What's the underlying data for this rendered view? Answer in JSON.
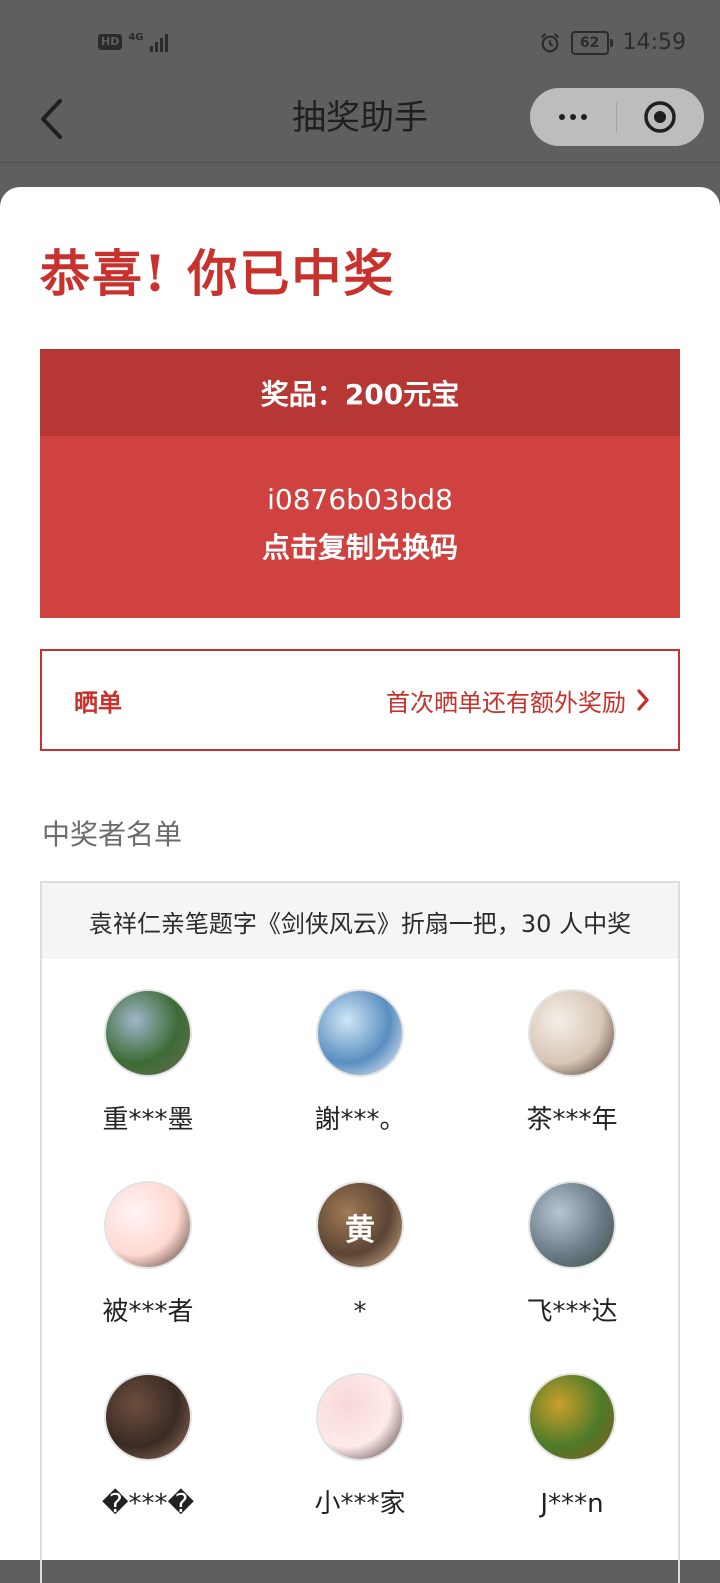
{
  "status_bar": {
    "hd": "HD",
    "network": "4G",
    "battery": "62",
    "time": "14:59"
  },
  "nav": {
    "title": "抽奖助手"
  },
  "result": {
    "congrats": "恭喜! 你已中奖",
    "prize_label": "奖品：200元宝",
    "redeem_code": "i0876b03bd8",
    "copy_text": "点击复制兑换码"
  },
  "share": {
    "label": "晒单",
    "hint": "首次晒单还有额外奖励"
  },
  "winners": {
    "title": "中奖者名单",
    "prize_desc": "袁祥仁亲笔题字《剑侠风云》折扇一把，30 人中奖",
    "list": [
      {
        "name": "重***墨",
        "avatar": "photo-garden",
        "colors": [
          "#9fb6c9",
          "#3d6b35",
          "#6d6d55"
        ]
      },
      {
        "name": "謝***。",
        "avatar": "cartoon-stitch",
        "colors": [
          "#cfe6f6",
          "#5a8ec0",
          "#ffffff"
        ]
      },
      {
        "name": "茶***年",
        "avatar": "photo-girl",
        "colors": [
          "#f4efe9",
          "#d8c6b6",
          "#3a2a22"
        ]
      },
      {
        "name": "被***者",
        "avatar": "cartoon-boy-glasses",
        "colors": [
          "#fff4f6",
          "#ffd9d0",
          "#3a2b25"
        ]
      },
      {
        "name": "￼*",
        "avatar": "photo-text-huang",
        "avatar_text": "黄",
        "colors": [
          "#a07a55",
          "#5c4535",
          "#d8b58e"
        ]
      },
      {
        "name": "飞***达",
        "avatar": "photo-man-lake",
        "colors": [
          "#b8c6d4",
          "#6a7b88",
          "#3d4a3a"
        ]
      },
      {
        "name": "�***�",
        "avatar": "photo-portrait-dark",
        "colors": [
          "#6d4f3f",
          "#3a2a24",
          "#a07862"
        ]
      },
      {
        "name": "小***家",
        "avatar": "photo-girl-pink",
        "colors": [
          "#f7d8d8",
          "#ffeaea",
          "#3b2a2a"
        ]
      },
      {
        "name": "J***n",
        "avatar": "cartoon-robot",
        "colors": [
          "#c9a02a",
          "#4d7a2a",
          "#8a5a1a"
        ]
      }
    ]
  }
}
